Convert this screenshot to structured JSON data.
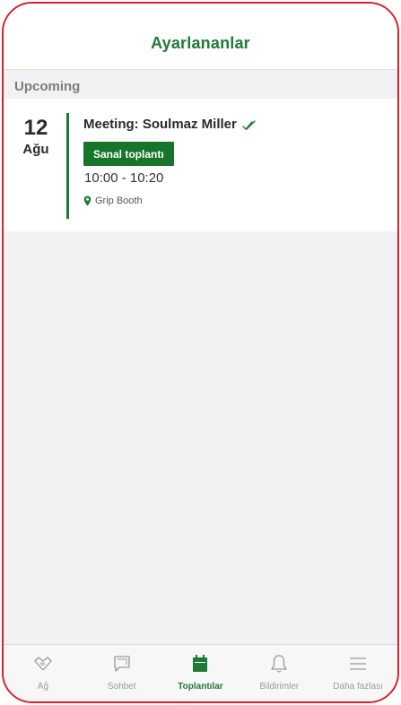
{
  "header": {
    "title": "Ayarlananlar"
  },
  "section": {
    "label": "Upcoming"
  },
  "meeting": {
    "day": "12",
    "month": "Ağu",
    "title": "Meeting: Soulmaz Miller",
    "badge": "Sanal toplantı",
    "time": "10:00 - 10:20",
    "location": "Grip Booth"
  },
  "tabs": [
    {
      "label": "Ağ",
      "icon": "handshake-icon"
    },
    {
      "label": "Sohbet",
      "icon": "chat-icon"
    },
    {
      "label": "Toplantılar",
      "icon": "calendar-icon",
      "active": true
    },
    {
      "label": "Bildirimler",
      "icon": "bell-icon"
    },
    {
      "label": "Daha fazlası",
      "icon": "menu-icon"
    }
  ],
  "colors": {
    "accent": "#1f7a35",
    "badge": "#16752a",
    "frame": "#d8202c"
  }
}
